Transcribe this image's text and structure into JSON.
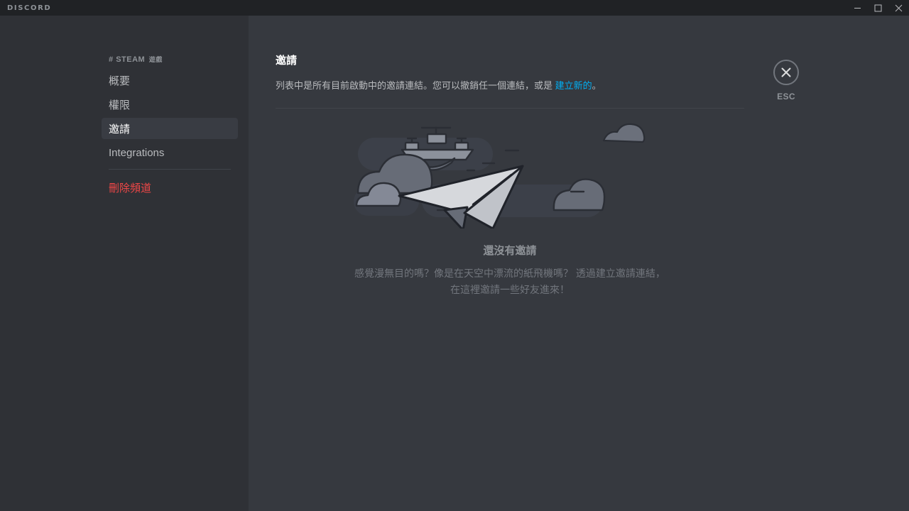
{
  "window": {
    "brand": "DISCORD",
    "controls": [
      {
        "name": "minimize-button",
        "glyph": "minimize"
      },
      {
        "name": "maximize-button",
        "glyph": "maximize"
      },
      {
        "name": "close-button",
        "glyph": "close"
      }
    ]
  },
  "sidebar": {
    "header_hash": "#",
    "header_name": "STEAM",
    "header_sub": "遊戲",
    "items": [
      {
        "label": "概要",
        "active": false
      },
      {
        "label": "權限",
        "active": false
      },
      {
        "label": "邀請",
        "active": true
      },
      {
        "label": "Integrations",
        "active": false
      }
    ],
    "delete_label": "刪除頻道"
  },
  "main": {
    "title": "邀請",
    "description_before": "列表中是所有目前啟動中的邀請連結。您可以撤銷任一個連結，或是 ",
    "description_link": "建立新的",
    "description_after": "。"
  },
  "close": {
    "label": "ESC"
  },
  "empty_state": {
    "title": "還沒有邀請",
    "body": "感覺漫無目的嗎？像是在天空中漂流的紙飛機嗎？ 透過建立邀請連結，在這裡邀請一些好友進來！",
    "illustration": "paper-plane-in-clouds"
  },
  "colors": {
    "titlebar_bg": "#202225",
    "sidebar_bg": "#2f3136",
    "content_bg": "#36393f",
    "active_item_bg": "#393c43",
    "text_primary": "#ffffff",
    "text_muted": "#b9bbbe",
    "text_dim": "#8e9297",
    "link": "#00aff4",
    "danger": "#f04747",
    "divider": "#40444b"
  }
}
